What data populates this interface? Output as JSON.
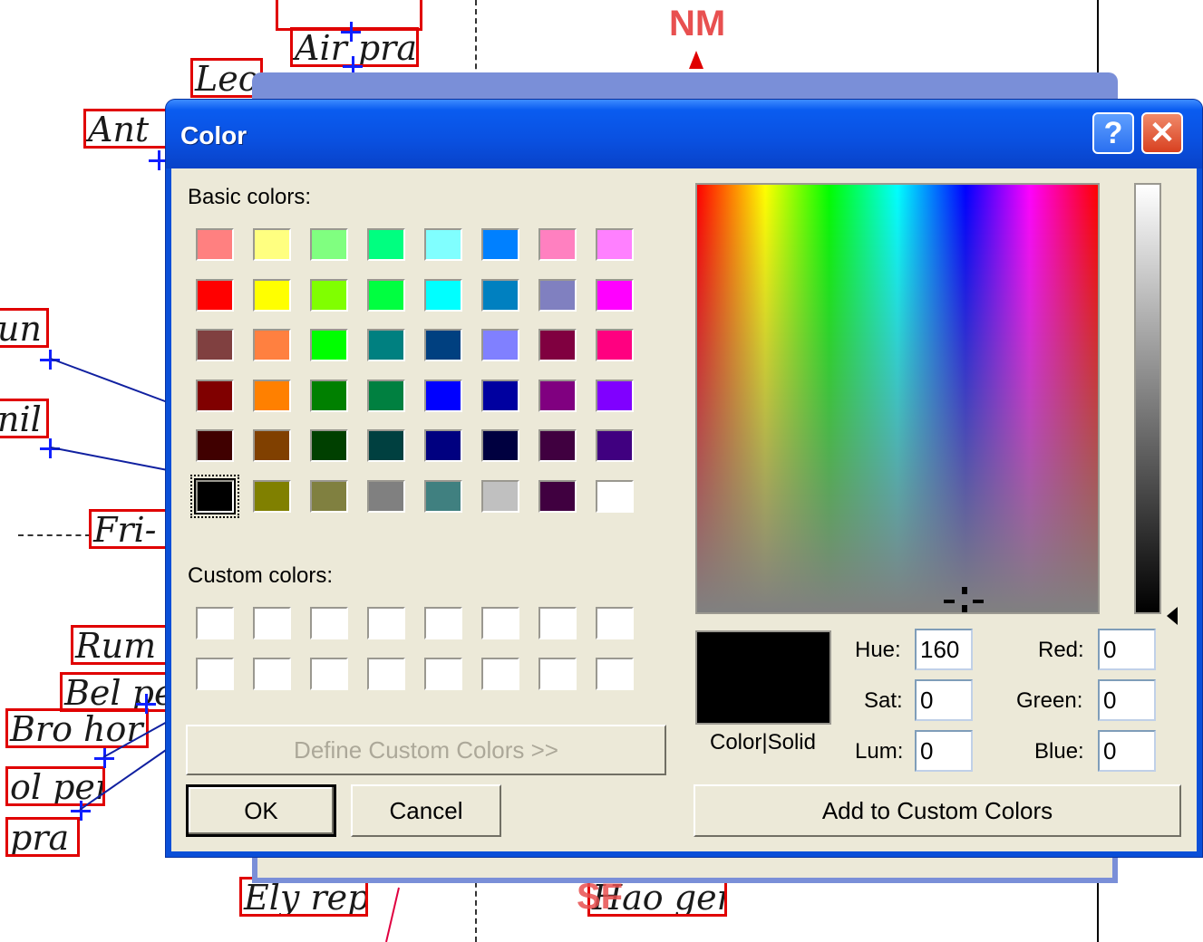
{
  "background": {
    "top_label": "NM",
    "bottom_label": "SF",
    "species_labels": [
      "Air pra",
      "Leo",
      "Ant",
      "un",
      "nil",
      "Fri-",
      "Rum",
      "Bel pe",
      "Bro hor",
      "ol per",
      "pra",
      "Ely rep",
      "Hao gen",
      "Fri"
    ]
  },
  "dialog": {
    "title": "Color",
    "help_glyph": "?",
    "close_glyph": "✕",
    "basic_colors_label": "Basic colors:",
    "custom_colors_label": "Custom colors:",
    "basic_colors": [
      "#ff8080",
      "#ffff80",
      "#80ff80",
      "#00ff80",
      "#80ffff",
      "#0080ff",
      "#ff80c0",
      "#ff80ff",
      "#ff0000",
      "#ffff00",
      "#80ff00",
      "#00ff40",
      "#00ffff",
      "#0080c0",
      "#8080c0",
      "#ff00ff",
      "#804040",
      "#ff8040",
      "#00ff00",
      "#008080",
      "#004080",
      "#8080ff",
      "#800040",
      "#ff0080",
      "#800000",
      "#ff8000",
      "#008000",
      "#008040",
      "#0000ff",
      "#0000a0",
      "#800080",
      "#8000ff",
      "#400000",
      "#804000",
      "#004000",
      "#004040",
      "#000080",
      "#000040",
      "#400040",
      "#400080",
      "#000000",
      "#808000",
      "#808040",
      "#808080",
      "#408080",
      "#c0c0c0",
      "#400040",
      "#ffffff"
    ],
    "selected_index": 40,
    "define_custom_label": "Define Custom Colors >>",
    "ok_label": "OK",
    "cancel_label": "Cancel",
    "color_solid_label": "Color|Solid",
    "hue_label": "Hue:",
    "sat_label": "Sat:",
    "lum_label": "Lum:",
    "red_label": "Red:",
    "green_label": "Green:",
    "blue_label": "Blue:",
    "hue_value": "160",
    "sat_value": "0",
    "lum_value": "0",
    "red_value": "0",
    "green_value": "0",
    "blue_value": "0",
    "add_custom_label": "Add to Custom Colors",
    "preview_color": "#000000"
  }
}
